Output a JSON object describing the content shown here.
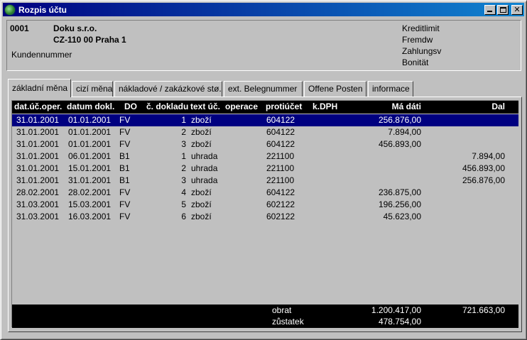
{
  "window": {
    "title": "Rozpis účtu"
  },
  "header": {
    "account_no": "0001",
    "company": "Doku s.r.o.",
    "address": "CZ-110 00 Praha 1",
    "customer_number_label": "Kundennummer",
    "kreditlimit_label": "Kreditlimit",
    "fremdw_label": "Fremdw",
    "zahlungsv_label": "Zahlungsv",
    "bonitat_label": "Bonität"
  },
  "tabs": [
    {
      "label": "základní měna",
      "active": true
    },
    {
      "label": "cizí měna",
      "active": false
    },
    {
      "label": "nákladové / zakázkové stø.",
      "active": false
    },
    {
      "label": "ext. Belegnummer",
      "active": false
    },
    {
      "label": "Offene Posten",
      "active": false
    },
    {
      "label": "informace",
      "active": false
    }
  ],
  "table": {
    "columns": [
      "dat.úč.oper.",
      "datum dokl.",
      "DO",
      "č. dokladu",
      "text úč.",
      "operace",
      "protiúčet",
      "k.DPH",
      "Má dáti",
      "Dal"
    ],
    "rows": [
      {
        "dat": "31.01.2001",
        "datum": "01.01.2001",
        "do": "FV",
        "num": "1",
        "text": "zboží",
        "prot": "604122",
        "md": "256.876,00",
        "dal": ""
      },
      {
        "dat": "31.01.2001",
        "datum": "01.01.2001",
        "do": "FV",
        "num": "2",
        "text": "zboží",
        "prot": "604122",
        "md": "7.894,00",
        "dal": ""
      },
      {
        "dat": "31.01.2001",
        "datum": "01.01.2001",
        "do": "FV",
        "num": "3",
        "text": "zboží",
        "prot": "604122",
        "md": "456.893,00",
        "dal": ""
      },
      {
        "dat": "31.01.2001",
        "datum": "06.01.2001",
        "do": "B1",
        "num": "1",
        "text": "uhrada",
        "prot": "221100",
        "md": "",
        "dal": "7.894,00"
      },
      {
        "dat": "31.01.2001",
        "datum": "15.01.2001",
        "do": "B1",
        "num": "2",
        "text": "uhrada",
        "prot": "221100",
        "md": "",
        "dal": "456.893,00"
      },
      {
        "dat": "31.01.2001",
        "datum": "31.01.2001",
        "do": "B1",
        "num": "3",
        "text": "uhrada",
        "prot": "221100",
        "md": "",
        "dal": "256.876,00"
      },
      {
        "dat": "28.02.2001",
        "datum": "28.02.2001",
        "do": "FV",
        "num": "4",
        "text": "zboží",
        "prot": "604122",
        "md": "236.875,00",
        "dal": ""
      },
      {
        "dat": "31.03.2001",
        "datum": "15.03.2001",
        "do": "FV",
        "num": "5",
        "text": "zboží",
        "prot": "602122",
        "md": "196.256,00",
        "dal": ""
      },
      {
        "dat": "31.03.2001",
        "datum": "16.03.2001",
        "do": "FV",
        "num": "6",
        "text": "zboží",
        "prot": "602122",
        "md": "45.623,00",
        "dal": ""
      }
    ],
    "selected_row": 0
  },
  "footer": {
    "obrat_label": "obrat",
    "obrat_md": "1.200.417,00",
    "obrat_dal": "721.663,00",
    "zustatek_label": "zůstatek",
    "zustatek_md": "478.754,00"
  },
  "colors": {
    "titlebar": "#000080",
    "selection": "#000080",
    "grid_header": "#000000",
    "face": "#c0c0c0"
  },
  "icons": {
    "app": "app-globe-icon",
    "minimize": "minimize-icon",
    "maximize": "maximize-icon",
    "close": "close-icon"
  }
}
